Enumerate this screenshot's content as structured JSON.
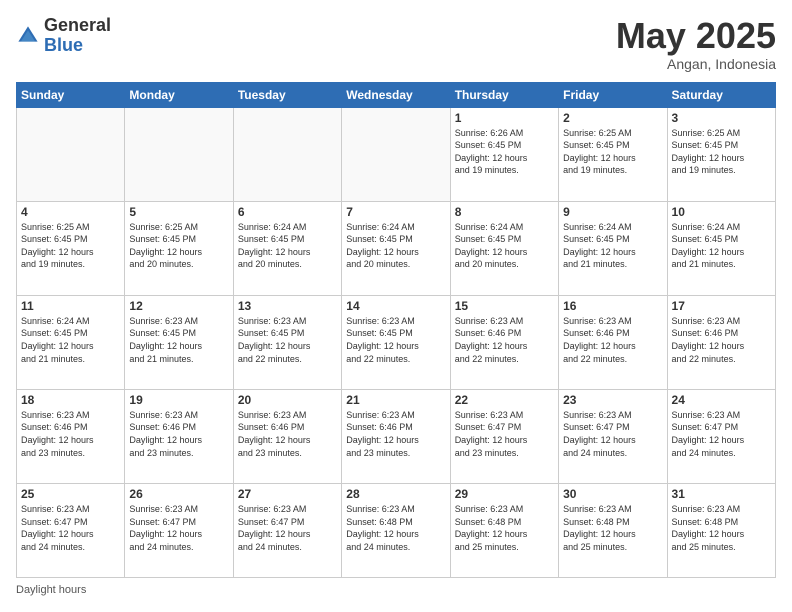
{
  "header": {
    "logo_general": "General",
    "logo_blue": "Blue",
    "month": "May 2025",
    "location": "Angan, Indonesia"
  },
  "days_of_week": [
    "Sunday",
    "Monday",
    "Tuesday",
    "Wednesday",
    "Thursday",
    "Friday",
    "Saturday"
  ],
  "weeks": [
    [
      {
        "day": "",
        "info": ""
      },
      {
        "day": "",
        "info": ""
      },
      {
        "day": "",
        "info": ""
      },
      {
        "day": "",
        "info": ""
      },
      {
        "day": "1",
        "info": "Sunrise: 6:26 AM\nSunset: 6:45 PM\nDaylight: 12 hours\nand 19 minutes."
      },
      {
        "day": "2",
        "info": "Sunrise: 6:25 AM\nSunset: 6:45 PM\nDaylight: 12 hours\nand 19 minutes."
      },
      {
        "day": "3",
        "info": "Sunrise: 6:25 AM\nSunset: 6:45 PM\nDaylight: 12 hours\nand 19 minutes."
      }
    ],
    [
      {
        "day": "4",
        "info": "Sunrise: 6:25 AM\nSunset: 6:45 PM\nDaylight: 12 hours\nand 19 minutes."
      },
      {
        "day": "5",
        "info": "Sunrise: 6:25 AM\nSunset: 6:45 PM\nDaylight: 12 hours\nand 20 minutes."
      },
      {
        "day": "6",
        "info": "Sunrise: 6:24 AM\nSunset: 6:45 PM\nDaylight: 12 hours\nand 20 minutes."
      },
      {
        "day": "7",
        "info": "Sunrise: 6:24 AM\nSunset: 6:45 PM\nDaylight: 12 hours\nand 20 minutes."
      },
      {
        "day": "8",
        "info": "Sunrise: 6:24 AM\nSunset: 6:45 PM\nDaylight: 12 hours\nand 20 minutes."
      },
      {
        "day": "9",
        "info": "Sunrise: 6:24 AM\nSunset: 6:45 PM\nDaylight: 12 hours\nand 21 minutes."
      },
      {
        "day": "10",
        "info": "Sunrise: 6:24 AM\nSunset: 6:45 PM\nDaylight: 12 hours\nand 21 minutes."
      }
    ],
    [
      {
        "day": "11",
        "info": "Sunrise: 6:24 AM\nSunset: 6:45 PM\nDaylight: 12 hours\nand 21 minutes."
      },
      {
        "day": "12",
        "info": "Sunrise: 6:23 AM\nSunset: 6:45 PM\nDaylight: 12 hours\nand 21 minutes."
      },
      {
        "day": "13",
        "info": "Sunrise: 6:23 AM\nSunset: 6:45 PM\nDaylight: 12 hours\nand 22 minutes."
      },
      {
        "day": "14",
        "info": "Sunrise: 6:23 AM\nSunset: 6:45 PM\nDaylight: 12 hours\nand 22 minutes."
      },
      {
        "day": "15",
        "info": "Sunrise: 6:23 AM\nSunset: 6:46 PM\nDaylight: 12 hours\nand 22 minutes."
      },
      {
        "day": "16",
        "info": "Sunrise: 6:23 AM\nSunset: 6:46 PM\nDaylight: 12 hours\nand 22 minutes."
      },
      {
        "day": "17",
        "info": "Sunrise: 6:23 AM\nSunset: 6:46 PM\nDaylight: 12 hours\nand 22 minutes."
      }
    ],
    [
      {
        "day": "18",
        "info": "Sunrise: 6:23 AM\nSunset: 6:46 PM\nDaylight: 12 hours\nand 23 minutes."
      },
      {
        "day": "19",
        "info": "Sunrise: 6:23 AM\nSunset: 6:46 PM\nDaylight: 12 hours\nand 23 minutes."
      },
      {
        "day": "20",
        "info": "Sunrise: 6:23 AM\nSunset: 6:46 PM\nDaylight: 12 hours\nand 23 minutes."
      },
      {
        "day": "21",
        "info": "Sunrise: 6:23 AM\nSunset: 6:46 PM\nDaylight: 12 hours\nand 23 minutes."
      },
      {
        "day": "22",
        "info": "Sunrise: 6:23 AM\nSunset: 6:47 PM\nDaylight: 12 hours\nand 23 minutes."
      },
      {
        "day": "23",
        "info": "Sunrise: 6:23 AM\nSunset: 6:47 PM\nDaylight: 12 hours\nand 24 minutes."
      },
      {
        "day": "24",
        "info": "Sunrise: 6:23 AM\nSunset: 6:47 PM\nDaylight: 12 hours\nand 24 minutes."
      }
    ],
    [
      {
        "day": "25",
        "info": "Sunrise: 6:23 AM\nSunset: 6:47 PM\nDaylight: 12 hours\nand 24 minutes."
      },
      {
        "day": "26",
        "info": "Sunrise: 6:23 AM\nSunset: 6:47 PM\nDaylight: 12 hours\nand 24 minutes."
      },
      {
        "day": "27",
        "info": "Sunrise: 6:23 AM\nSunset: 6:47 PM\nDaylight: 12 hours\nand 24 minutes."
      },
      {
        "day": "28",
        "info": "Sunrise: 6:23 AM\nSunset: 6:48 PM\nDaylight: 12 hours\nand 24 minutes."
      },
      {
        "day": "29",
        "info": "Sunrise: 6:23 AM\nSunset: 6:48 PM\nDaylight: 12 hours\nand 25 minutes."
      },
      {
        "day": "30",
        "info": "Sunrise: 6:23 AM\nSunset: 6:48 PM\nDaylight: 12 hours\nand 25 minutes."
      },
      {
        "day": "31",
        "info": "Sunrise: 6:23 AM\nSunset: 6:48 PM\nDaylight: 12 hours\nand 25 minutes."
      }
    ]
  ],
  "footer": {
    "daylight_label": "Daylight hours"
  }
}
